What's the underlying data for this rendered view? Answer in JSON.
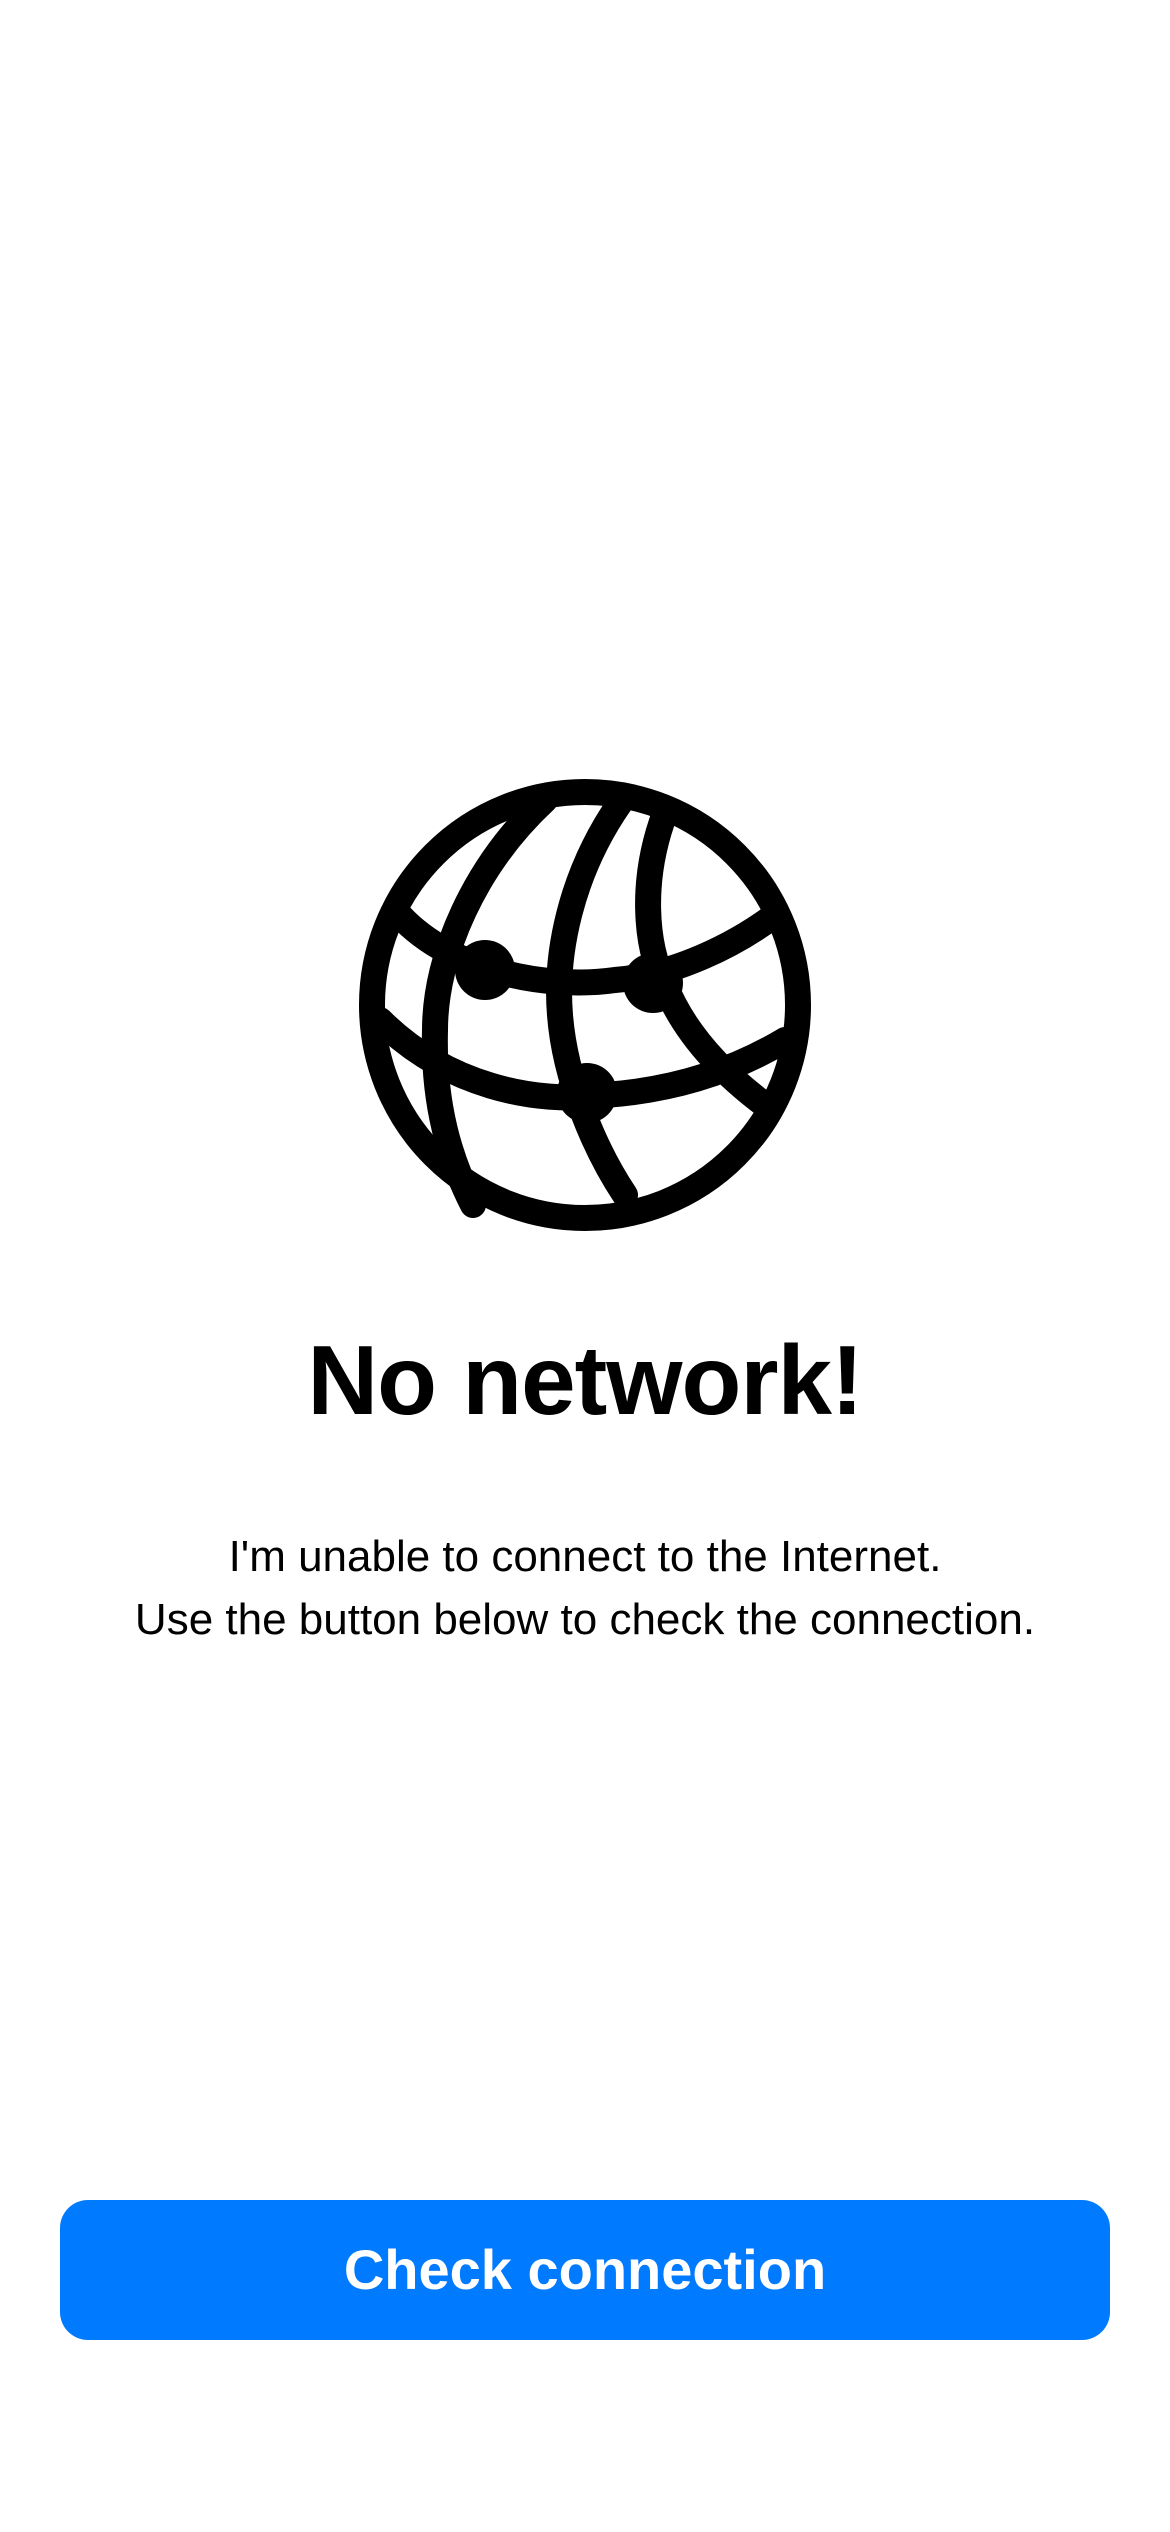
{
  "screen": {
    "icon": "network-globe-icon",
    "title": "No network!",
    "message_lines": [
      "I'm unable to connect to the Internet.",
      "Use the button below to check the connection."
    ]
  },
  "actions": {
    "check_connection_label": "Check connection"
  },
  "colors": {
    "background": "#FFFFFF",
    "text": "#000000",
    "accent": "#007AFF",
    "button_text": "#FFFFFF"
  }
}
